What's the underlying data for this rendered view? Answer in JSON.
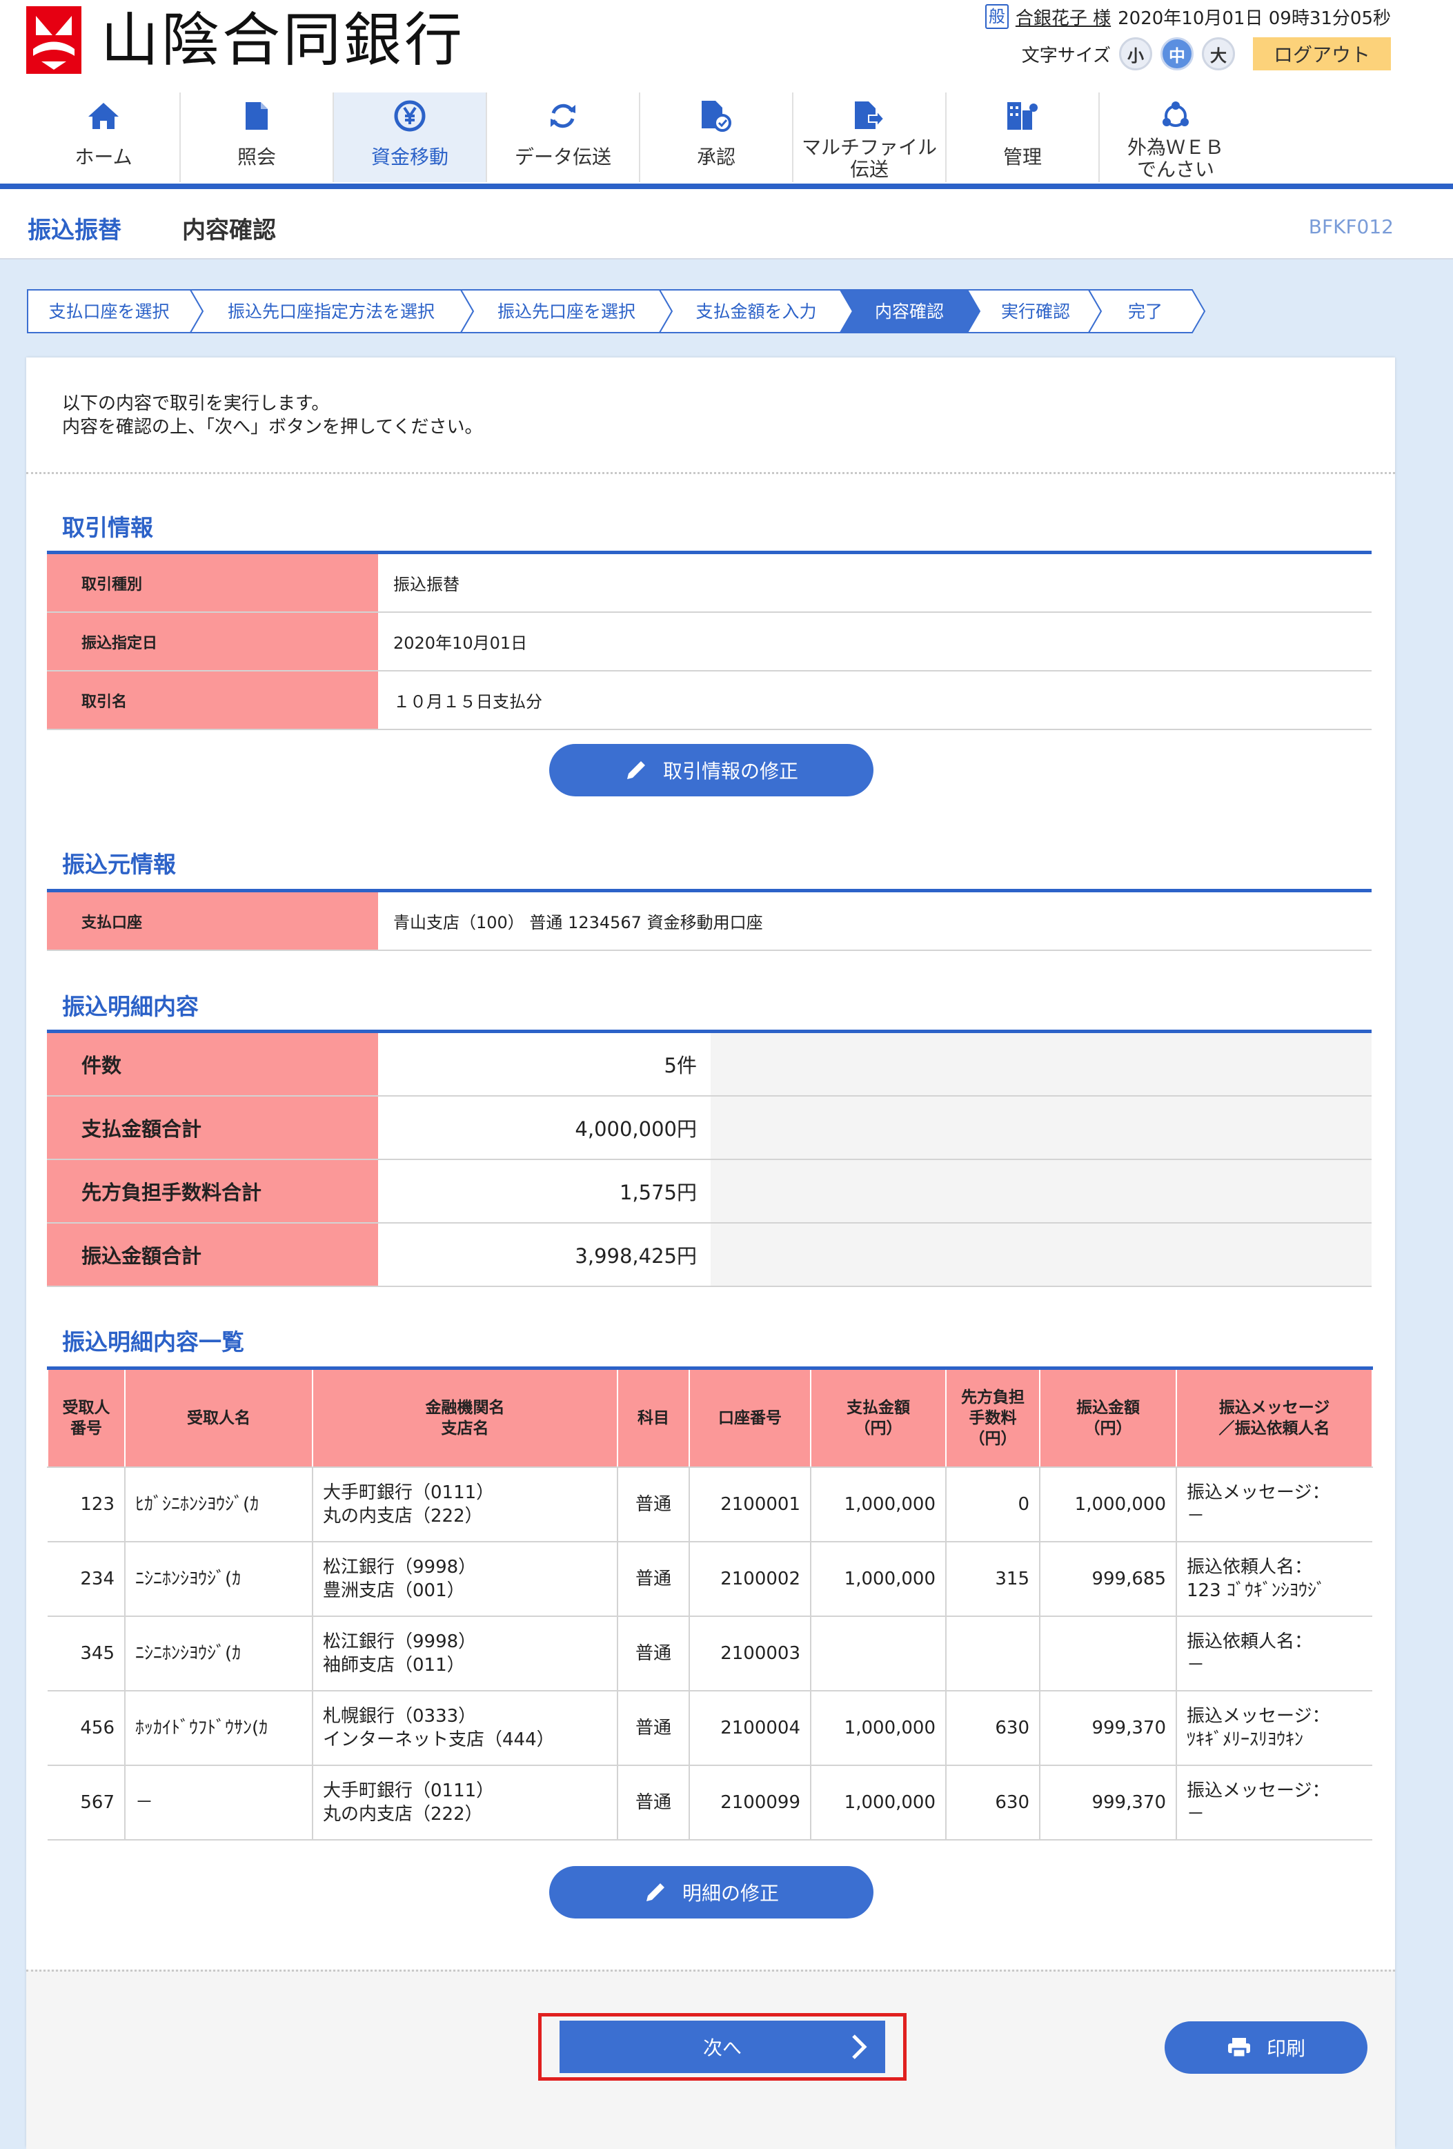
{
  "header": {
    "bank_name": "山陰合同銀行",
    "user_badge": "般",
    "user_name": "合銀花子 様",
    "datetime": "2020年10月01日 09時31分05秒",
    "font_size_label": "文字サイズ",
    "font_sizes": [
      "小",
      "中",
      "大"
    ],
    "logout_label": "ログアウト"
  },
  "nav": [
    {
      "label": "ホーム",
      "icon": "home-icon"
    },
    {
      "label": "照会",
      "icon": "document-icon"
    },
    {
      "label": "資金移動",
      "icon": "yen-transfer-icon"
    },
    {
      "label": "データ伝送",
      "icon": "sync-icon"
    },
    {
      "label": "承認",
      "icon": "approve-icon"
    },
    {
      "label": "マルチファイル",
      "label2": "伝送",
      "icon": "file-send-icon"
    },
    {
      "label": "管理",
      "icon": "admin-icon"
    },
    {
      "label": "外為ＷＥＢ",
      "label2": "でんさい",
      "icon": "network-icon"
    }
  ],
  "page": {
    "title": "振込振替",
    "subtitle": "内容確認",
    "screen_id": "BFKF012"
  },
  "steps": [
    "支払口座を選択",
    "振込先口座指定方法を選択",
    "振込先口座を選択",
    "支払金額を入力",
    "内容確認",
    "実行確認",
    "完了"
  ],
  "intro": {
    "line1": "以下の内容で取引を実行します。",
    "line2": "内容を確認の上、「次へ」ボタンを押してください。"
  },
  "transaction": {
    "title": "取引情報",
    "rows": [
      {
        "label": "取引種別",
        "value": "振込振替"
      },
      {
        "label": "振込指定日",
        "value": "2020年10月01日"
      },
      {
        "label": "取引名",
        "value": "１０月１５日支払分"
      }
    ],
    "edit_label": "取引情報の修正"
  },
  "source": {
    "title": "振込元情報",
    "label": "支払口座",
    "value": "青山支店（100） 普通 1234567 資金移動用口座"
  },
  "summary": {
    "title": "振込明細内容",
    "rows": [
      {
        "label": "件数",
        "value": "5件"
      },
      {
        "label": "支払金額合計",
        "value": "4,000,000円"
      },
      {
        "label": "先方負担手数料合計",
        "value": "1,575円"
      },
      {
        "label": "振込金額合計",
        "value": "3,998,425円"
      }
    ]
  },
  "detail": {
    "title": "振込明細内容一覧",
    "headers": [
      {
        "l1": "受取人",
        "l2": "番号",
        "l3": ""
      },
      {
        "l1": "受取人名",
        "l2": "",
        "l3": ""
      },
      {
        "l1": "金融機関名",
        "l2": "支店名",
        "l3": ""
      },
      {
        "l1": "科目",
        "l2": "",
        "l3": ""
      },
      {
        "l1": "口座番号",
        "l2": "",
        "l3": ""
      },
      {
        "l1": "支払金額",
        "l2": "（円）",
        "l3": ""
      },
      {
        "l1": "先方負担",
        "l2": "手数料",
        "l3": "（円）"
      },
      {
        "l1": "振込金額",
        "l2": "（円）",
        "l3": ""
      },
      {
        "l1": "振込メッセージ",
        "l2": "／振込依頼人名",
        "l3": ""
      }
    ],
    "rows": [
      {
        "no": "123",
        "name": "ﾋｶﾞｼﾆﾎﾝｼﾖｳｼﾞ(ｶ",
        "bank": "大手町銀行（0111）",
        "branch": "丸の内支店（222）",
        "type": "普通",
        "account": "2100001",
        "pay": "1,000,000",
        "fee": "0",
        "amount": "1,000,000",
        "msg1": "振込メッセージ：",
        "msg2": "－"
      },
      {
        "no": "234",
        "name": "ﾆｼﾆﾎﾝｼﾖｳｼﾞ(ｶ",
        "bank": "松江銀行（9998）",
        "branch": "豊洲支店（001）",
        "type": "普通",
        "account": "2100002",
        "pay": "1,000,000",
        "fee": "315",
        "amount": "999,685",
        "msg1": "振込依頼人名：",
        "msg2": "123 ｺﾞｳｷﾞﾝｼﾖｳｼﾞ"
      },
      {
        "no": "345",
        "name": "ﾆｼﾆﾎﾝｼﾖｳｼﾞ(ｶ",
        "bank": "松江銀行（9998）",
        "branch": "袖師支店（011）",
        "type": "普通",
        "account": "2100003",
        "pay": "",
        "fee": "",
        "amount": "",
        "msg1": "振込依頼人名：",
        "msg2": "－"
      },
      {
        "no": "456",
        "name": "ﾎｯｶｲﾄﾞｳﾌﾄﾞｳｻﾝ(ｶ",
        "bank": "札幌銀行（0333）",
        "branch": "インターネット支店（444）",
        "type": "普通",
        "account": "2100004",
        "pay": "1,000,000",
        "fee": "630",
        "amount": "999,370",
        "msg1": "振込メッセージ：",
        "msg2": "ﾂｷｷﾞﾒﾘｰｽﾘﾖｳｷﾝ"
      },
      {
        "no": "567",
        "name": "－",
        "bank": "大手町銀行（0111）",
        "branch": "丸の内支店（222）",
        "type": "普通",
        "account": "2100099",
        "pay": "1,000,000",
        "fee": "630",
        "amount": "999,370",
        "msg1": "振込メッセージ：",
        "msg2": "－"
      }
    ],
    "edit_label": "明細の修正"
  },
  "footer": {
    "next_label": "次へ",
    "print_label": "印刷"
  },
  "colors": {
    "accent": "#2c62c8",
    "button": "#3b6fd1",
    "header_cell": "#fb9898",
    "logout": "#fcd27a",
    "highlight": "#e0201f"
  }
}
